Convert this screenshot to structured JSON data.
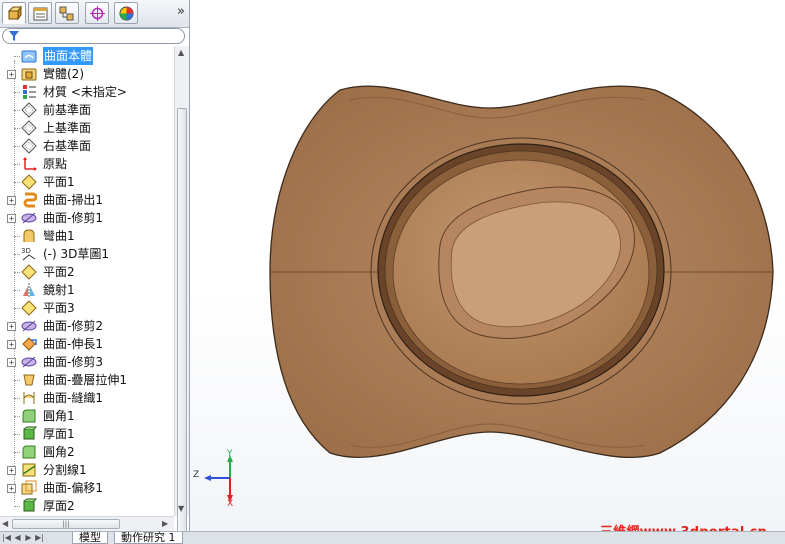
{
  "tabs": {
    "items": [
      {
        "name": "feature-manager-tab"
      },
      {
        "name": "property-manager-tab"
      },
      {
        "name": "configuration-manager-tab"
      },
      {
        "name": "dimxpert-manager-tab"
      },
      {
        "name": "display-manager-tab"
      }
    ],
    "more": "»"
  },
  "tree": {
    "items": [
      {
        "label": "曲面本體",
        "icon": "surface-bodies-folder-icon",
        "expand": "",
        "selected": true
      },
      {
        "label": "實體(2)",
        "icon": "solid-bodies-folder-icon",
        "expand": "+"
      },
      {
        "label": "材質 <未指定>",
        "icon": "material-icon",
        "expand": ""
      },
      {
        "label": "前基準面",
        "icon": "plane-icon",
        "expand": ""
      },
      {
        "label": "上基準面",
        "icon": "plane-icon",
        "expand": ""
      },
      {
        "label": "右基準面",
        "icon": "plane-icon",
        "expand": ""
      },
      {
        "label": "原點",
        "icon": "origin-icon",
        "expand": ""
      },
      {
        "label": "平面1",
        "icon": "plane-feature-icon",
        "expand": ""
      },
      {
        "label": "曲面-掃出1",
        "icon": "surface-sweep-icon",
        "expand": "+"
      },
      {
        "label": "曲面-修剪1",
        "icon": "surface-trim-icon",
        "expand": "+"
      },
      {
        "label": "彎曲1",
        "icon": "flex-icon",
        "expand": ""
      },
      {
        "label": "(-) 3D草圖1",
        "icon": "3d-sketch-icon",
        "expand": ""
      },
      {
        "label": "平面2",
        "icon": "plane-feature-icon",
        "expand": ""
      },
      {
        "label": "鏡射1",
        "icon": "mirror-icon",
        "expand": ""
      },
      {
        "label": "平面3",
        "icon": "plane-feature-icon",
        "expand": ""
      },
      {
        "label": "曲面-修剪2",
        "icon": "surface-trim-icon",
        "expand": "+"
      },
      {
        "label": "曲面-伸長1",
        "icon": "surface-extend-icon",
        "expand": "+"
      },
      {
        "label": "曲面-修剪3",
        "icon": "surface-trim-icon",
        "expand": "+"
      },
      {
        "label": "曲面-疊層拉伸1",
        "icon": "surface-loft-icon",
        "expand": ""
      },
      {
        "label": "曲面-縫織1",
        "icon": "surface-knit-icon",
        "expand": ""
      },
      {
        "label": "圓角1",
        "icon": "fillet-icon",
        "expand": ""
      },
      {
        "label": "厚面1",
        "icon": "thicken-icon",
        "expand": ""
      },
      {
        "label": "圓角2",
        "icon": "fillet-icon",
        "expand": ""
      },
      {
        "label": "分割線1",
        "icon": "split-line-icon",
        "expand": "+"
      },
      {
        "label": "曲面-偏移1",
        "icon": "surface-offset-icon",
        "expand": "+"
      },
      {
        "label": "厚面2",
        "icon": "thicken-icon",
        "expand": ""
      }
    ]
  },
  "bottom_tabs": [
    "模型",
    "動作研究 1"
  ],
  "triad": {
    "y": "Y",
    "z": "Z",
    "x": "X"
  },
  "watermark": "三維網www.3dportal.cn",
  "colors": {
    "hat": "#a87a55",
    "selection": "#3399ff",
    "watermark": "#e5241c"
  }
}
